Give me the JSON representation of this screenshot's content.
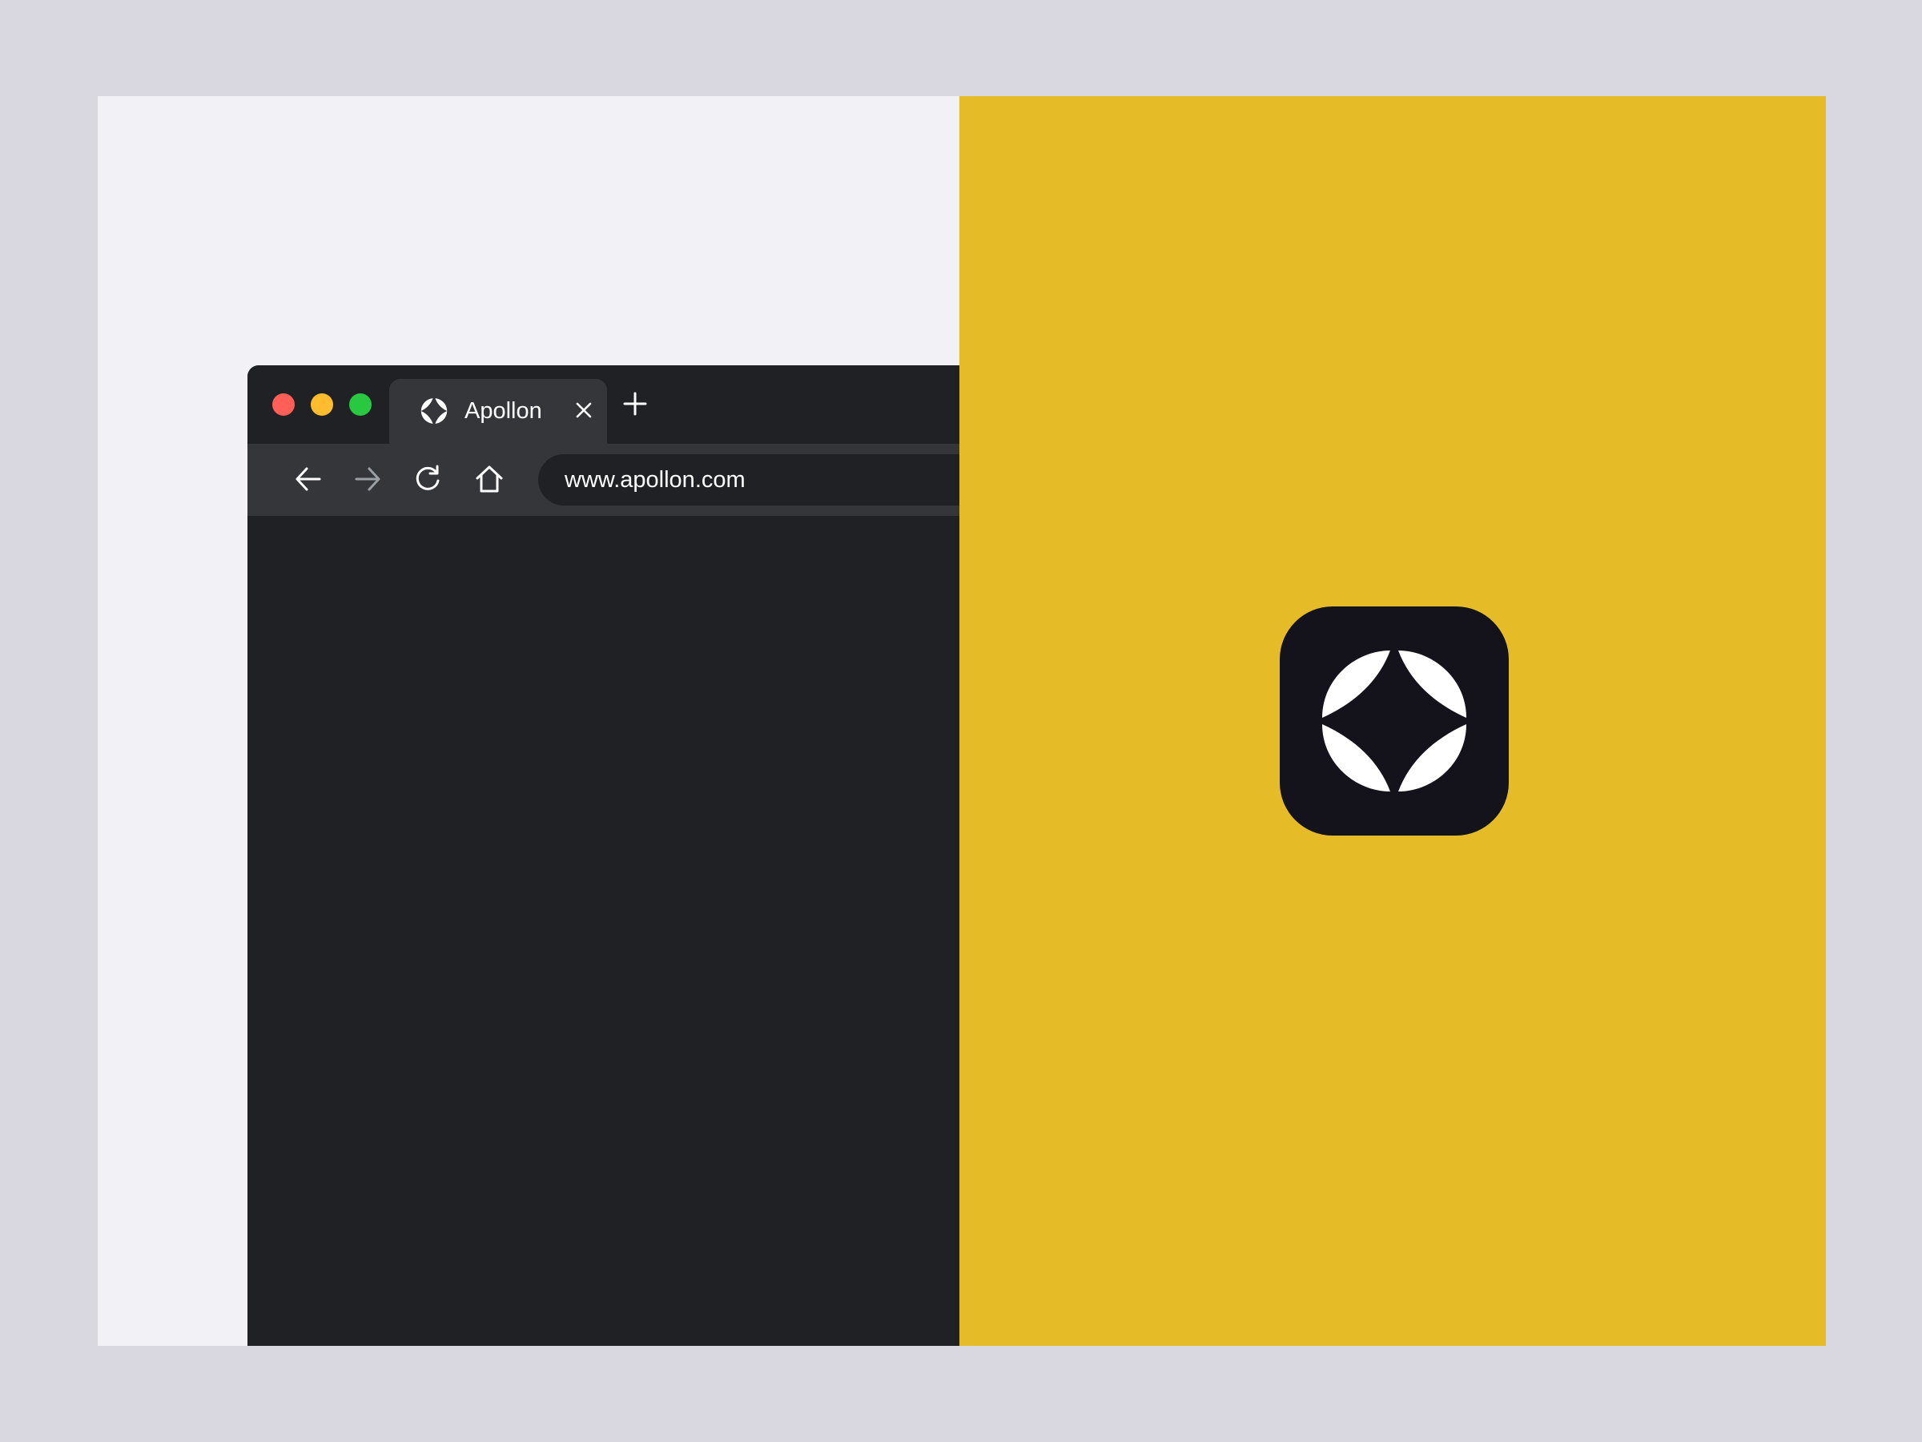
{
  "colors": {
    "backdrop": "#d9d8e1",
    "left_panel": "#f2f2f6",
    "right_panel": "#e5bc27",
    "window_bg": "#202125",
    "tab_bg": "#35363a",
    "toolbar_bg": "#35363a",
    "address_bg": "#202125",
    "text": "#ffffff",
    "muted_icon": "#9aa0a6",
    "traffic_red": "#ff5f57",
    "traffic_yellow": "#febc2e",
    "traffic_green": "#28c840",
    "app_icon_bg": "#14131c",
    "app_icon_glyph": "#ffffff"
  },
  "browser": {
    "tab": {
      "title": "Apollon",
      "icon": "apollon-logo-icon",
      "close_icon": "close-icon"
    },
    "new_tab_icon": "plus-icon",
    "toolbar": {
      "back_icon": "arrow-left-icon",
      "forward_icon": "arrow-right-icon",
      "reload_icon": "reload-icon",
      "home_icon": "home-icon"
    },
    "address_bar": {
      "url": "www.apollon.com"
    }
  },
  "app_icon": {
    "icon": "apollon-logo-icon"
  }
}
